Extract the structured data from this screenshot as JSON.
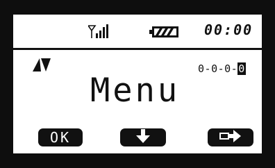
{
  "status_bar": {
    "signal_icon": "signal-strength-icon",
    "battery_icon": "battery-icon",
    "clock": "00:00"
  },
  "main": {
    "title": "Menu",
    "scroll_indicator_icon": "up-down-triangle-icon",
    "counter": {
      "digits": [
        "0",
        "0",
        "0"
      ],
      "highlighted_digit": "0"
    }
  },
  "softkeys": {
    "ok_label": "OK",
    "down_icon": "down-arrow-icon",
    "next_icon": "enter-arrow-icon"
  },
  "colors": {
    "bezel": "#0e0e0e",
    "screen": "#ffffff",
    "ink": "#111111"
  }
}
